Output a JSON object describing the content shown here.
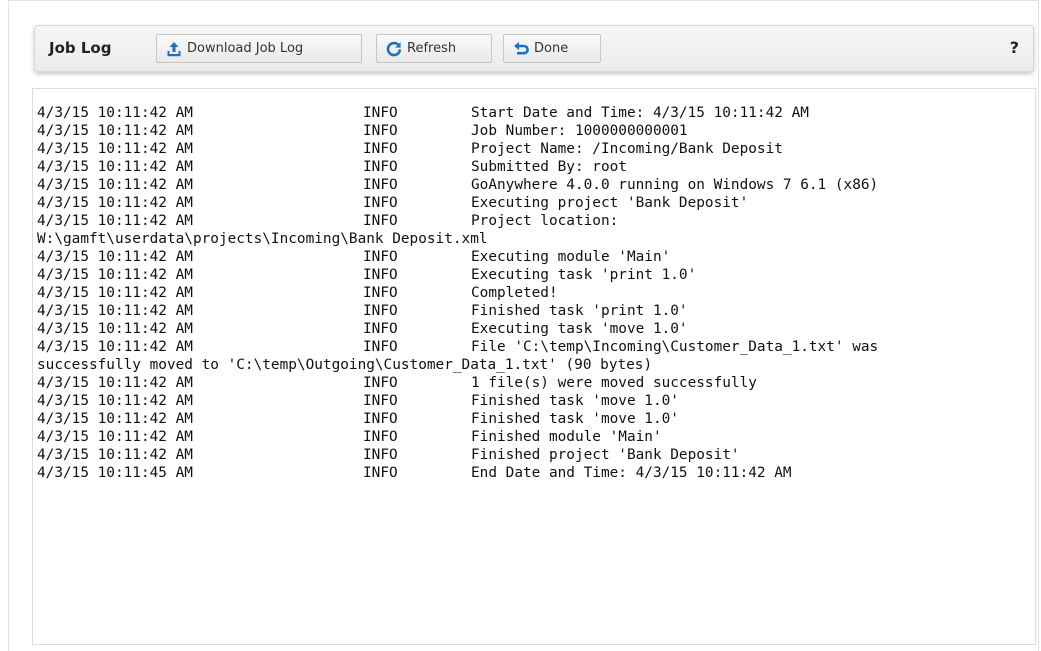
{
  "toolbar": {
    "title": "Job Log",
    "download_label": "Download Job Log",
    "refresh_label": "Refresh",
    "done_label": "Done",
    "help_label": "?"
  },
  "colors": {
    "icon_blue": "#1f6fc1",
    "toolbar_bg": "#efefef",
    "panel_border": "#dcdcdc"
  },
  "icons": {
    "download": "upload-arrow-icon",
    "refresh": "refresh-icon",
    "done": "undo-arrow-icon",
    "help": "help-icon"
  },
  "log": {
    "rows": [
      {
        "ts": "4/3/15 10:11:42 AM",
        "level": "INFO",
        "msg": "Start Date and Time: 4/3/15 10:11:42 AM"
      },
      {
        "ts": "4/3/15 10:11:42 AM",
        "level": "INFO",
        "msg": "Job Number: 1000000000001"
      },
      {
        "ts": "4/3/15 10:11:42 AM",
        "level": "INFO",
        "msg": "Project Name: /Incoming/Bank Deposit"
      },
      {
        "ts": "4/3/15 10:11:42 AM",
        "level": "INFO",
        "msg": "Submitted By: root"
      },
      {
        "ts": "4/3/15 10:11:42 AM",
        "level": "INFO",
        "msg": "GoAnywhere 4.0.0 running on Windows 7 6.1 (x86)"
      },
      {
        "ts": "4/3/15 10:11:42 AM",
        "level": "INFO",
        "msg": "Executing project 'Bank Deposit'"
      },
      {
        "ts": "4/3/15 10:11:42 AM",
        "level": "INFO",
        "msg": "Project location:"
      },
      {
        "cont": "W:\\gamft\\userdata\\projects\\Incoming\\Bank Deposit.xml"
      },
      {
        "ts": "4/3/15 10:11:42 AM",
        "level": "INFO",
        "msg": "Executing module 'Main'"
      },
      {
        "ts": "4/3/15 10:11:42 AM",
        "level": "INFO",
        "msg": "Executing task 'print 1.0'"
      },
      {
        "ts": "4/3/15 10:11:42 AM",
        "level": "INFO",
        "msg": "Completed!"
      },
      {
        "ts": "4/3/15 10:11:42 AM",
        "level": "INFO",
        "msg": "Finished task 'print 1.0'"
      },
      {
        "ts": "4/3/15 10:11:42 AM",
        "level": "INFO",
        "msg": "Executing task 'move 1.0'"
      },
      {
        "ts": "4/3/15 10:11:42 AM",
        "level": "INFO",
        "msg": "File 'C:\\temp\\Incoming\\Customer_Data_1.txt' was"
      },
      {
        "cont": "successfully moved to 'C:\\temp\\Outgoing\\Customer_Data_1.txt' (90 bytes)"
      },
      {
        "ts": "4/3/15 10:11:42 AM",
        "level": "INFO",
        "msg": "1 file(s) were moved successfully"
      },
      {
        "ts": "4/3/15 10:11:42 AM",
        "level": "INFO",
        "msg": "Finished task 'move 1.0'"
      },
      {
        "ts": "4/3/15 10:11:42 AM",
        "level": "INFO",
        "msg": "Finished task 'move 1.0'"
      },
      {
        "ts": "4/3/15 10:11:42 AM",
        "level": "INFO",
        "msg": "Finished module 'Main'"
      },
      {
        "ts": "4/3/15 10:11:42 AM",
        "level": "INFO",
        "msg": "Finished project 'Bank Deposit'"
      },
      {
        "ts": "4/3/15 10:11:45 AM",
        "level": "INFO",
        "msg": "End Date and Time: 4/3/15 10:11:42 AM"
      }
    ]
  }
}
